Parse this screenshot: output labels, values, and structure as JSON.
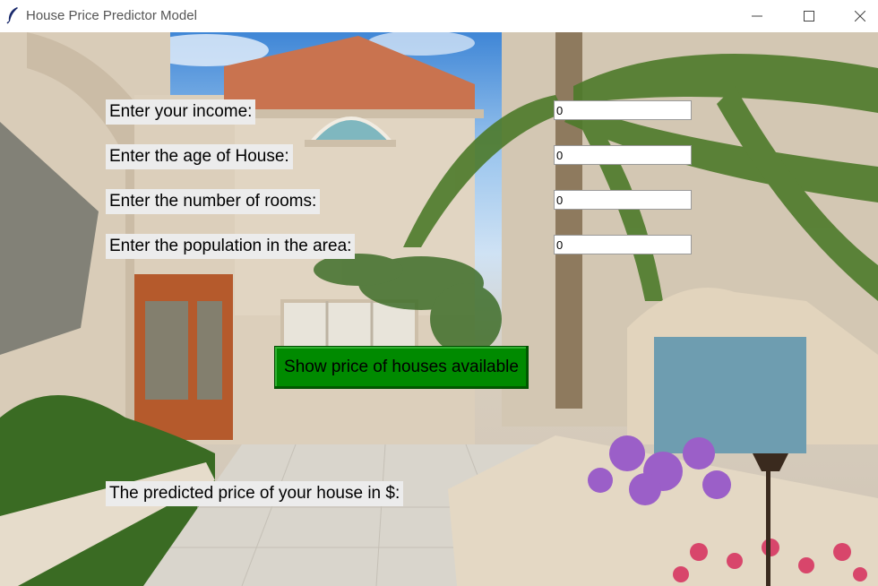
{
  "window": {
    "title": "House Price Predictor Model",
    "app_icon": "feather-icon"
  },
  "form": {
    "income_label": "Enter your income:",
    "income_value": "0",
    "age_label": "Enter the age of House:",
    "age_value": "0",
    "rooms_label": "Enter the number of rooms:",
    "rooms_value": "0",
    "population_label": "Enter the population in the area:",
    "population_value": "0",
    "predict_button": "Show price of houses available",
    "result_label": "The predicted price of your house in $:"
  },
  "colors": {
    "button_bg": "#008a00",
    "label_bg": "#ececec"
  }
}
